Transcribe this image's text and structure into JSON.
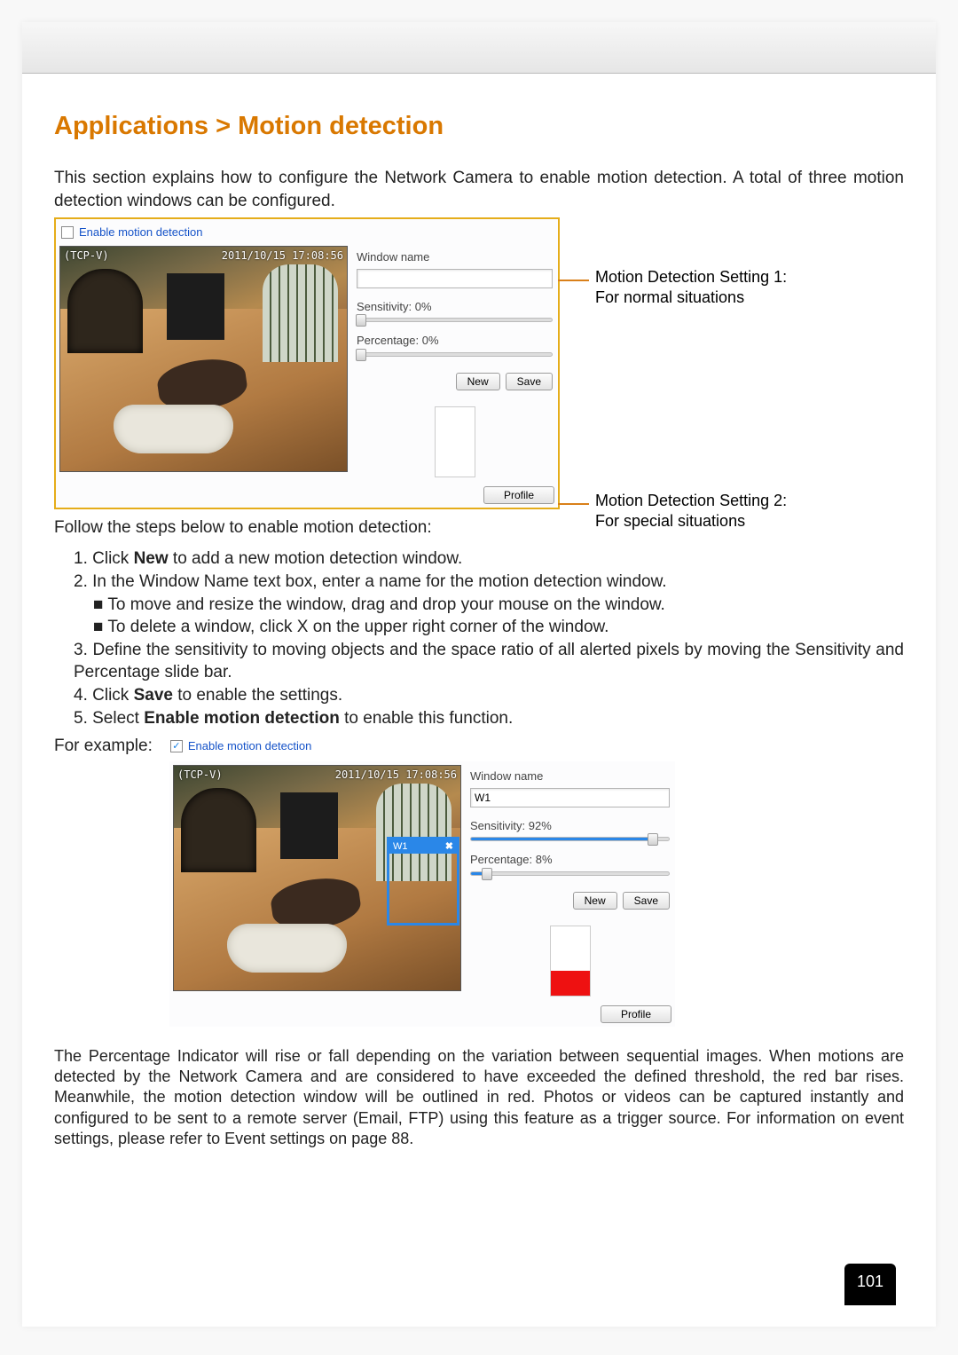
{
  "title": "Applications > Motion detection",
  "intro": "This section explains how to configure the Network Camera to enable motion detection. A total of three motion detection windows can be configured.",
  "panel1": {
    "enable_label": "Enable motion detection",
    "enable_checked": false,
    "camera_label": "(TCP-V)",
    "camera_time": "2011/10/15  17:08:56",
    "window_name_label": "Window name",
    "window_name_value": "",
    "sensitivity_label": "Sensitivity: 0%",
    "sensitivity_pct": 0,
    "percentage_label": "Percentage: 0%",
    "percentage_pct": 0,
    "new_btn": "New",
    "save_btn": "Save",
    "profile_btn": "Profile"
  },
  "callout1": {
    "l1": "Motion Detection Setting 1:",
    "l2": "For normal situations"
  },
  "callout2": {
    "l1": "Motion Detection Setting 2:",
    "l2": "For special situations"
  },
  "follow_steps_intro": "Follow the steps below to enable motion detection:",
  "steps": {
    "s1a": "1. Click ",
    "s1b": "New",
    "s1c": " to add a new motion detection window.",
    "s2": "2. In the Window Name text box, enter a name for the motion detection window.",
    "s2a": "■ To move and resize the window, drag and drop your mouse on the window.",
    "s2b": "■ To delete a window, click X on the upper right corner of the window.",
    "s3": "3. Define the sensitivity to moving objects and the space ratio of all alerted pixels by moving the Sensitivity and Percentage slide bar.",
    "s4a": "4. Click ",
    "s4b": "Save",
    "s4c": " to enable the settings.",
    "s5a": "5. Select ",
    "s5b": "Enable motion detection",
    "s5c": " to enable this function."
  },
  "for_example": "For example:",
  "panel2": {
    "enable_label": "Enable motion detection",
    "enable_checked": true,
    "camera_label": "(TCP-V)",
    "camera_time": "2011/10/15  17:08:56",
    "detect_window_name": "W1",
    "window_name_label": "Window name",
    "window_name_value": "W1",
    "sensitivity_label": "Sensitivity: 92%",
    "sensitivity_pct": 92,
    "percentage_label": "Percentage: 8%",
    "percentage_pct": 8,
    "new_btn": "New",
    "save_btn": "Save",
    "profile_btn": "Profile",
    "indicator_pct": 35
  },
  "closing": "The Percentage Indicator will rise or fall depending on the variation between sequential images. When motions are detected by the Network Camera and are considered to have exceeded the defined threshold, the red bar rises. Meanwhile, the motion detection window will be outlined in red. Photos or videos can be captured instantly and configured to be sent to a remote server (Email, FTP) using this feature as a trigger source. For information on event settings, please refer to Event settings on page 88.",
  "page_number": "101"
}
